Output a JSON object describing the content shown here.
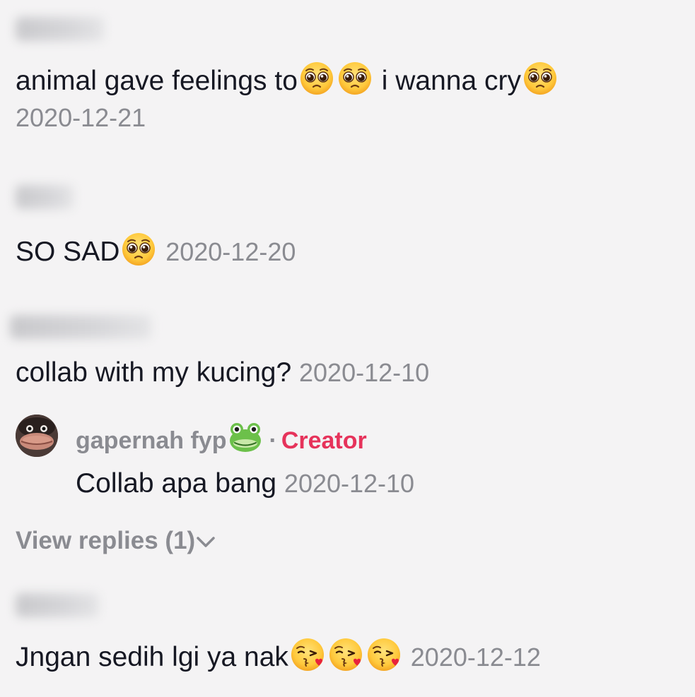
{
  "comments": [
    {
      "text": "animal gave feelings to",
      "text_after_emoji": "i wanna cry",
      "date": "2020-12-21",
      "emojis": [
        "pleading-face-emoji",
        "pleading-face-emoji",
        "pleading-face-emoji"
      ]
    },
    {
      "text": "SO SAD",
      "date": "2020-12-20",
      "emojis": [
        "pleading-face-emoji"
      ]
    },
    {
      "text": "collab with my kucing?",
      "date": "2020-12-10",
      "reply": {
        "author": "gapernah fyp",
        "author_emoji": "frog-face-emoji",
        "separator": "·",
        "badge": "Creator",
        "text": "Collab apa bang",
        "date": "2020-12-10"
      },
      "view_replies": "View replies (1)"
    },
    {
      "text": "Jngan sedih lgi ya nak",
      "date": "2020-12-12",
      "emojis": [
        "kissing-heart-emoji",
        "kissing-heart-emoji",
        "kissing-heart-emoji"
      ]
    }
  ],
  "colors": {
    "background": "#f4f3f4",
    "text": "#161823",
    "muted": "#8a8b91",
    "creator": "#e6335b"
  }
}
